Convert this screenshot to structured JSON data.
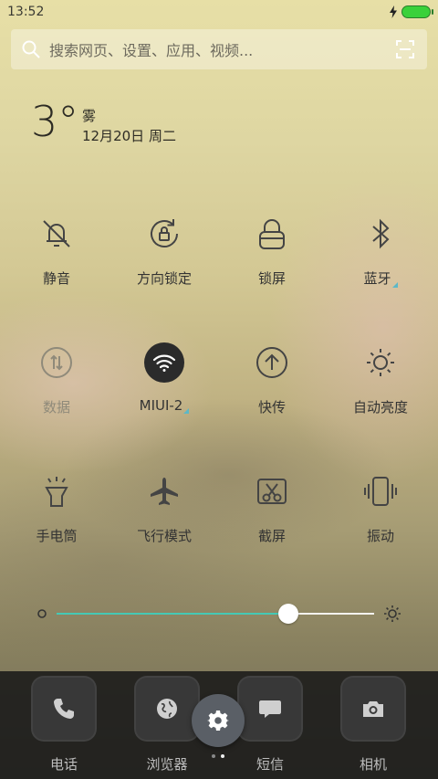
{
  "status_bar": {
    "time": "13:52"
  },
  "search": {
    "placeholder": "搜索网页、设置、应用、视频..."
  },
  "weather": {
    "temperature": "3°",
    "condition": "雾",
    "date": "12月20日 周二"
  },
  "toggles": [
    {
      "label": "静音",
      "icon": "bell-off-icon",
      "active": false
    },
    {
      "label": "方向锁定",
      "icon": "rotation-lock-icon",
      "active": false
    },
    {
      "label": "锁屏",
      "icon": "lock-icon",
      "active": false
    },
    {
      "label": "蓝牙",
      "icon": "bluetooth-icon",
      "active": false
    },
    {
      "label": "数据",
      "icon": "data-transfer-icon",
      "active": false
    },
    {
      "label": "MIUI-2",
      "icon": "wifi-icon",
      "active": true
    },
    {
      "label": "快传",
      "icon": "upload-icon",
      "active": false
    },
    {
      "label": "自动亮度",
      "icon": "sun-icon",
      "active": false
    },
    {
      "label": "手电筒",
      "icon": "flashlight-icon",
      "active": false
    },
    {
      "label": "飞行模式",
      "icon": "airplane-icon",
      "active": false
    },
    {
      "label": "截屏",
      "icon": "screenshot-icon",
      "active": false
    },
    {
      "label": "振动",
      "icon": "vibrate-icon",
      "active": false
    }
  ],
  "brightness": {
    "level": 0.73
  },
  "dock": {
    "apps": [
      {
        "label": "电话",
        "icon": "phone-icon"
      },
      {
        "label": "浏览器",
        "icon": "globe-icon"
      },
      {
        "label": "短信",
        "icon": "message-icon"
      },
      {
        "label": "相机",
        "icon": "camera-icon"
      }
    ],
    "page_count": 2,
    "current_page": 2
  },
  "colors": {
    "accent": "#45c9b5",
    "battery": "#3ad13a"
  }
}
